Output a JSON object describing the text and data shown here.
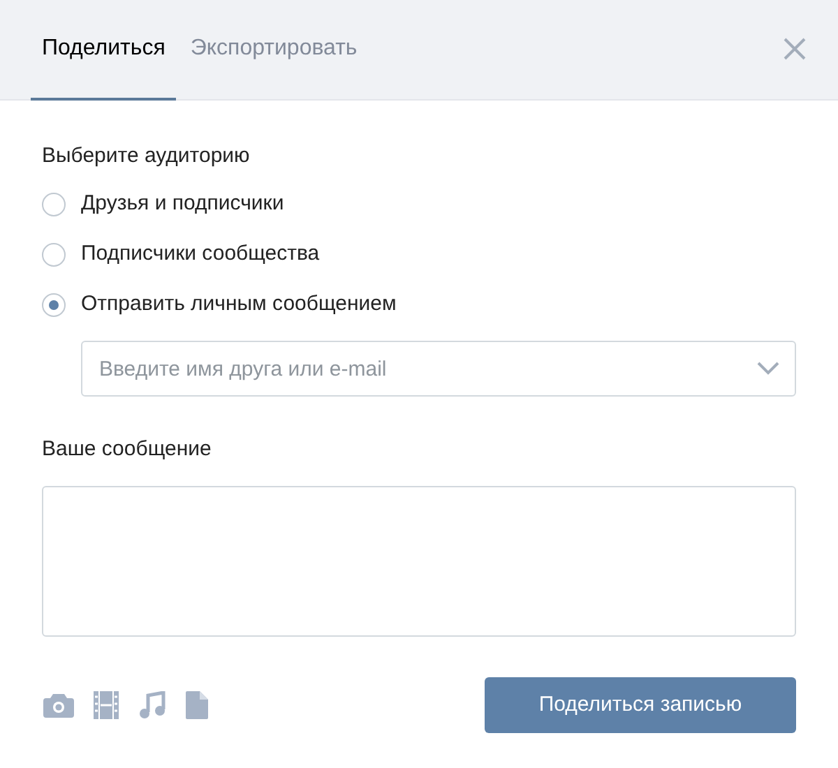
{
  "tabs": [
    {
      "label": "Поделиться",
      "selected": true
    },
    {
      "label": "Экспортировать",
      "selected": false
    }
  ],
  "audience": {
    "title": "Выберите аудиторию",
    "options": [
      {
        "label": "Друзья и подписчики",
        "selected": false
      },
      {
        "label": "Подписчики сообщества",
        "selected": false
      },
      {
        "label": "Отправить личным сообщением",
        "selected": true
      }
    ]
  },
  "friend_select": {
    "placeholder": "Введите имя друга или e-mail"
  },
  "message": {
    "label": "Ваше сообщение"
  },
  "submit_button": "Поделиться записью"
}
